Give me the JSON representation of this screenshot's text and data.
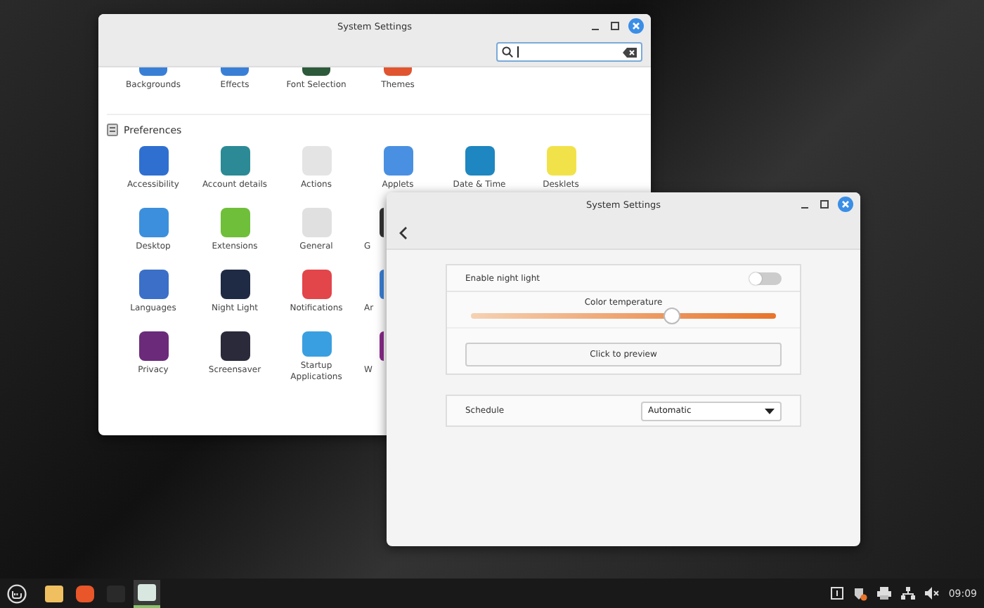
{
  "settings_window": {
    "title": "System Settings",
    "top_row": [
      {
        "label": "Backgrounds"
      },
      {
        "label": "Effects"
      },
      {
        "label": "Font Selection"
      },
      {
        "label": "Themes"
      }
    ],
    "section": {
      "title": "Preferences"
    },
    "items": [
      {
        "label": "Accessibility",
        "cut": false
      },
      {
        "label": "Account details",
        "cut": false
      },
      {
        "label": "Actions",
        "cut": false
      },
      {
        "label": "Applets",
        "cut": false
      },
      {
        "label": "Date & Time",
        "cut": false
      },
      {
        "label": "Desklets",
        "cut": false
      },
      {
        "label": "Desktop",
        "cut": false
      },
      {
        "label": "Extensions",
        "cut": false
      },
      {
        "label": "General",
        "cut": false
      },
      {
        "label": "G",
        "cut": true
      },
      {
        "label": "Languages",
        "cut": false
      },
      {
        "label": "Night Light",
        "cut": false
      },
      {
        "label": "Notifications",
        "cut": false
      },
      {
        "label": "Ar",
        "cut": true
      },
      {
        "label": "Privacy",
        "cut": false
      },
      {
        "label": "Screensaver",
        "cut": false
      },
      {
        "label": "Startup Applications",
        "cut": false
      },
      {
        "label": "W",
        "cut": true
      }
    ]
  },
  "night_light_window": {
    "title": "System Settings",
    "enable": {
      "label": "Enable night light",
      "on": false
    },
    "temperature": {
      "label": "Color temperature",
      "level": 0.66
    },
    "preview_button": "Click to preview",
    "schedule": {
      "label": "Schedule",
      "value": "Automatic"
    }
  },
  "taskbar": {
    "apps": [
      {
        "selected": false
      },
      {
        "selected": false
      },
      {
        "selected": false
      },
      {
        "selected": true
      }
    ],
    "clock": "09:09"
  }
}
